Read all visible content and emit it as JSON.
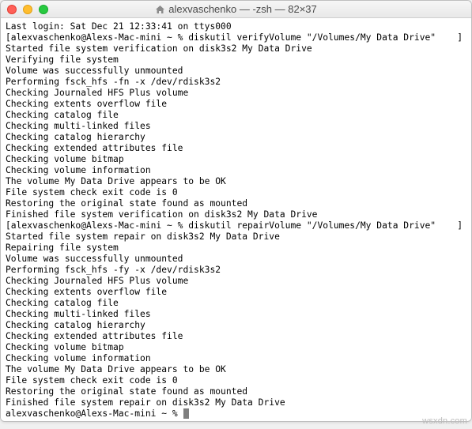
{
  "titlebar": {
    "title": "alexvaschenko — -zsh — 82×37",
    "icon_name": "home-icon"
  },
  "terminal": {
    "lines": [
      "Last login: Sat Dec 21 12:33:41 on ttys000",
      "[alexvaschenko@Alexs-Mac-mini ~ % diskutil verifyVolume \"/Volumes/My Data Drive\"    ]",
      "Started file system verification on disk3s2 My Data Drive",
      "Verifying file system",
      "Volume was successfully unmounted",
      "Performing fsck_hfs -fn -x /dev/rdisk3s2",
      "Checking Journaled HFS Plus volume",
      "Checking extents overflow file",
      "Checking catalog file",
      "Checking multi-linked files",
      "Checking catalog hierarchy",
      "Checking extended attributes file",
      "Checking volume bitmap",
      "Checking volume information",
      "The volume My Data Drive appears to be OK",
      "File system check exit code is 0",
      "Restoring the original state found as mounted",
      "Finished file system verification on disk3s2 My Data Drive",
      "[alexvaschenko@Alexs-Mac-mini ~ % diskutil repairVolume \"/Volumes/My Data Drive\"    ]",
      "Started file system repair on disk3s2 My Data Drive",
      "Repairing file system",
      "Volume was successfully unmounted",
      "Performing fsck_hfs -fy -x /dev/rdisk3s2",
      "Checking Journaled HFS Plus volume",
      "Checking extents overflow file",
      "Checking catalog file",
      "Checking multi-linked files",
      "Checking catalog hierarchy",
      "Checking extended attributes file",
      "Checking volume bitmap",
      "Checking volume information",
      "The volume My Data Drive appears to be OK",
      "File system check exit code is 0",
      "Restoring the original state found as mounted",
      "Finished file system repair on disk3s2 My Data Drive"
    ],
    "prompt": "alexvaschenko@Alexs-Mac-mini ~ % "
  },
  "watermark": "wsxdn.com"
}
